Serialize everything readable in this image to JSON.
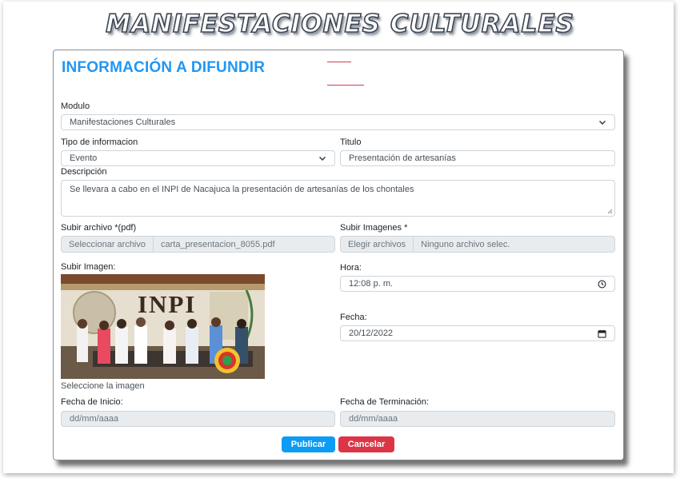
{
  "banner": {
    "title": "MANIFESTACIONES CULTURALES"
  },
  "form": {
    "title": "INFORMACIÓN A DIFUNDIR",
    "modulo": {
      "label": "Modulo",
      "value": "Manifestaciones Culturales"
    },
    "tipo": {
      "label": "Tipo de informacion",
      "value": "Evento"
    },
    "titulo": {
      "label": "Titulo",
      "value": "Presentación de artesanías"
    },
    "descripcion": {
      "label": "Descripción",
      "value": "Se llevara a cabo en el INPI de Nacajuca la presentación de artesanías de los chontales"
    },
    "archivo": {
      "label": "Subir archivo *(pdf)",
      "button": "Seleccionar archivo",
      "filename": "carta_presentacion_8055.pdf"
    },
    "imagenes": {
      "label": "Subir Imagenes *",
      "button": "Elegir archivos",
      "filename": "Ninguno archivo selec."
    },
    "imagen": {
      "label": "Subir Imagen:",
      "sign_text": "INPI",
      "caption": "Seleccione la imagen"
    },
    "hora": {
      "label": "Hora:",
      "value": "12:08 p. m."
    },
    "fecha": {
      "label": "Fecha:",
      "value": "20/12/2022"
    },
    "fecha_inicio": {
      "label": "Fecha de Inicio:",
      "placeholder": "dd/mm/aaaa"
    },
    "fecha_fin": {
      "label": "Fecha de Terminación:",
      "placeholder": "dd/mm/aaaa"
    },
    "publicar_label": "Publicar",
    "cancelar_label": "Cancelar"
  },
  "colors": {
    "title_blue": "#2196f3",
    "publish_blue": "#0d9cf3",
    "cancel_red": "#dc3545",
    "accent_line": "#d33a4a"
  },
  "icons": {
    "select": "chevron-down-icon",
    "time": "clock-icon",
    "date": "calendar-icon",
    "resize": "resize-grip-icon"
  }
}
